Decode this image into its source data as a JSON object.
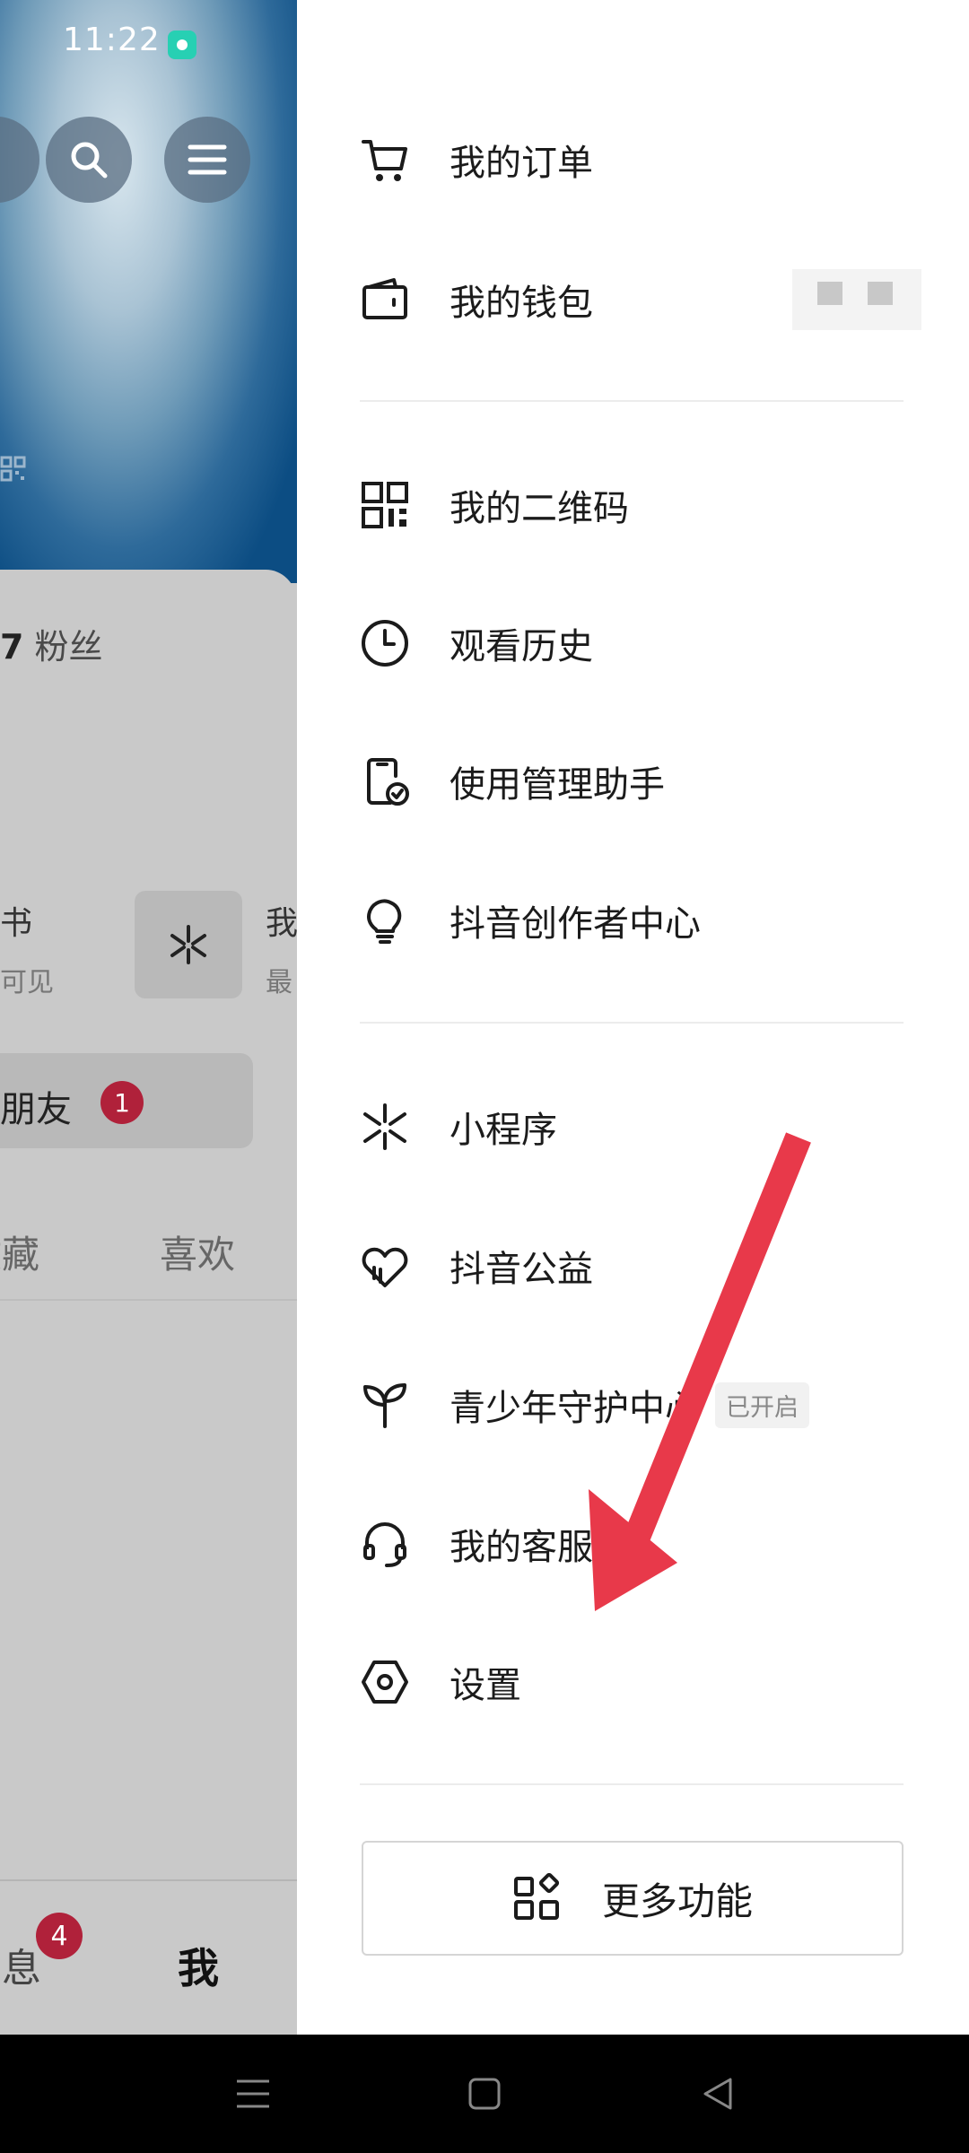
{
  "status_bar": {
    "time": "11:22",
    "app_icon": "chat-bubble-icon"
  },
  "profile_page": {
    "fans_count_fragment": "7",
    "fans_label": "粉丝",
    "card1_title_fragment": "书",
    "card1_sub_fragment": "可见",
    "card2_title_fragment": "我",
    "card2_sub_fragment": "最",
    "friend_label_fragment": "加朋友",
    "friend_badge": "1",
    "tabs": {
      "collect_fragment": "收藏",
      "like": "喜欢"
    },
    "bottom_nav": {
      "message_fragment": "消息",
      "message_badge": "4",
      "me": "我"
    }
  },
  "drawer": {
    "items": [
      {
        "label": "我的订单",
        "icon": "cart-icon"
      },
      {
        "label": "我的钱包",
        "icon": "wallet-icon"
      },
      {
        "label": "我的二维码",
        "icon": "qr-code-icon"
      },
      {
        "label": "观看历史",
        "icon": "clock-icon"
      },
      {
        "label": "使用管理助手",
        "icon": "phone-check-icon"
      },
      {
        "label": "抖音创作者中心",
        "icon": "lightbulb-icon"
      },
      {
        "label": "小程序",
        "icon": "mini-program-icon"
      },
      {
        "label": "抖音公益",
        "icon": "heart-hand-icon"
      },
      {
        "label": "青少年守护中心",
        "icon": "sprout-icon",
        "status": "已开启"
      },
      {
        "label": "我的客服",
        "icon": "headset-icon"
      },
      {
        "label": "设置",
        "icon": "settings-hex-icon"
      }
    ],
    "more_button": "更多功能"
  },
  "system_nav": {
    "menu": "menu-icon",
    "home": "home-icon",
    "back": "back-icon"
  },
  "colors": {
    "arrow": "#e8394a",
    "badge": "#b0213a"
  }
}
